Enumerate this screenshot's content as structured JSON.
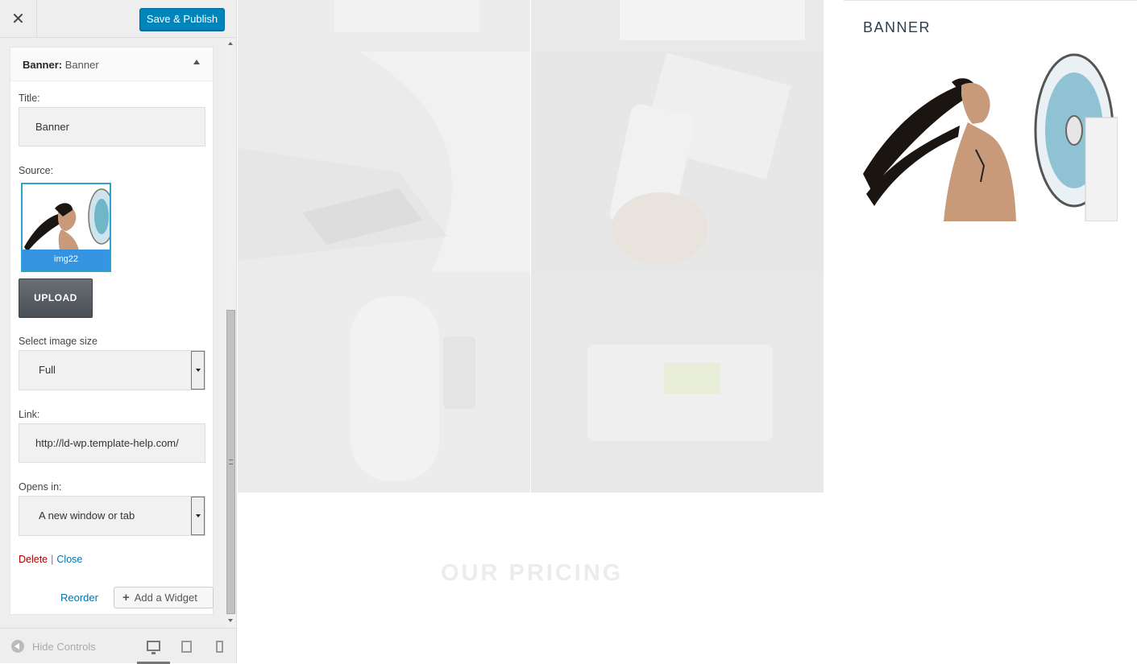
{
  "header": {
    "close_label": "✕",
    "save_label": "Save & Publish"
  },
  "widget": {
    "type": "Banner:",
    "name": "Banner",
    "title_label": "Title:",
    "title_value": "Banner",
    "source_label": "Source:",
    "image_caption": "img22",
    "upload_label": "UPLOAD",
    "size_label": "Select image size",
    "size_value": "Full",
    "link_label": "Link:",
    "link_value": "http://ld-wp.template-help.com/",
    "opens_label": "Opens in:",
    "opens_value": "A new window or tab",
    "delete_label": "Delete",
    "separator": "|",
    "close_label": "Close"
  },
  "footer_actions": {
    "reorder_label": "Reorder",
    "add_widget_label": "Add a Widget"
  },
  "panel_footer": {
    "hide_controls_label": "Hide Controls",
    "devices": [
      "desktop-icon",
      "tablet-icon",
      "mobile-icon"
    ]
  },
  "preview": {
    "section_title": "OUR PRICING",
    "sidebar_widget_title": "BANNER"
  },
  "colors": {
    "primary_button": "#0085ba",
    "link": "#0073aa",
    "delete": "#aa0000",
    "sidebar_heading": "#2c3e50"
  }
}
